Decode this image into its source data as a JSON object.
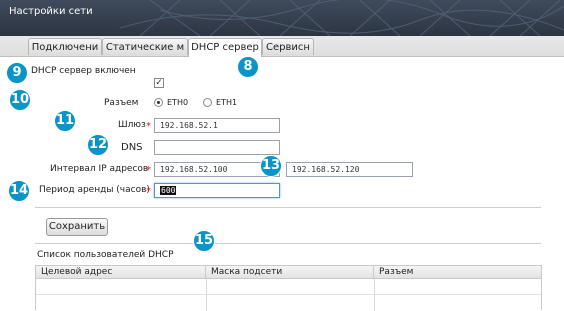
{
  "window": {
    "title": "Настройки сети"
  },
  "tabs": [
    {
      "label": "Подключени",
      "active": false
    },
    {
      "label": "Статические м",
      "active": false
    },
    {
      "label": "DHCP сервер",
      "active": true
    },
    {
      "label": "Сервисн",
      "active": false
    }
  ],
  "form": {
    "dhcp_enabled_label": "DHCP сервер включен",
    "dhcp_enabled_checked": true,
    "port_label": "Разъем",
    "port_options": [
      "ETH0",
      "ETH1"
    ],
    "port_selected": "ETH0",
    "gateway_label": "Шлюз",
    "gateway_value": "192.168.52.1",
    "dns_label": "DNS",
    "dns_value": "",
    "ip_range_label": "Интервал IP адресов",
    "ip_range_start": "192.168.52.100",
    "ip_range_end": "192.168.52.120",
    "lease_label": "Период аренды (часов)",
    "lease_value": "600",
    "required_marker": "*",
    "save_label": "Сохранить"
  },
  "dhcp_users": {
    "title": "Список пользователей DHCP",
    "columns": [
      "Целевой адрес",
      "Маска подсети",
      "Разъем"
    ],
    "rows": []
  },
  "callouts": [
    "8",
    "9",
    "10",
    "11",
    "12",
    "13",
    "14",
    "15"
  ],
  "colors": {
    "callout": "#0a95c9",
    "titlebar": "#343e4d",
    "required": "#d32020"
  }
}
